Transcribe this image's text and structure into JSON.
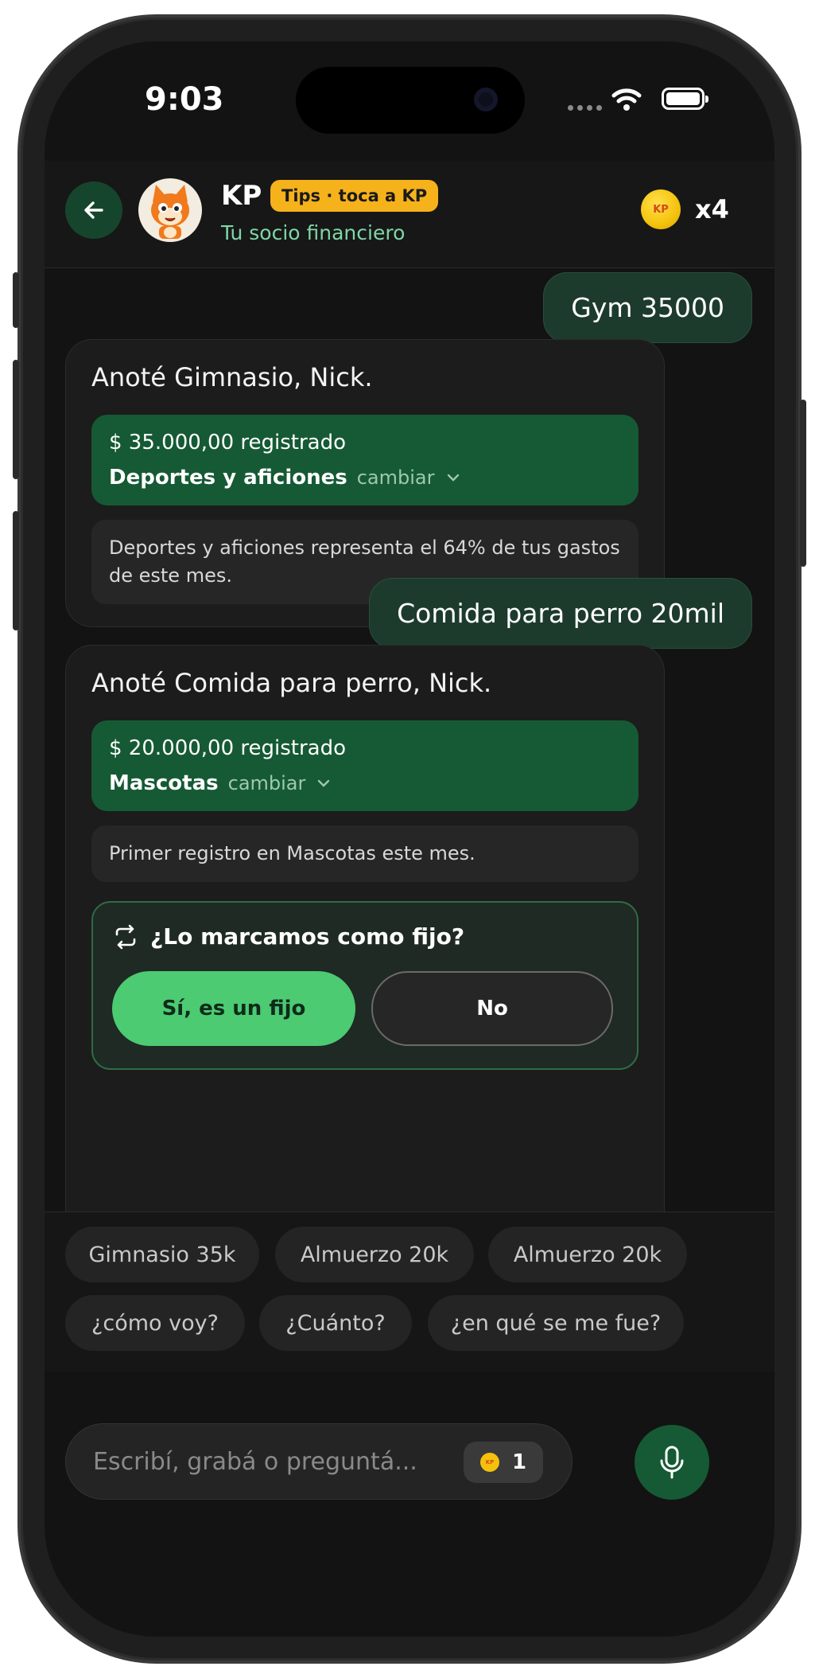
{
  "status_bar": {
    "time": "9:03"
  },
  "header": {
    "agent_name": "KP",
    "tips_badge": "Tips · toca a KP",
    "subtitle": "Tu socio financiero",
    "coin_label": "KP",
    "coin_multiplier": "x4"
  },
  "chat": {
    "messages": [
      {
        "role": "user",
        "text": "Gym 35000"
      },
      {
        "role": "bot",
        "title": "Anoté Gimnasio, Nick.",
        "amount": "$ 35.000,00 registrado",
        "category": "Deportes y aficiones",
        "change_label": "cambiar",
        "info": "Deportes y aficiones representa el 64% de tus gastos de este mes."
      },
      {
        "role": "user",
        "text": "Comida para perro 20mil"
      },
      {
        "role": "bot",
        "title": "Anoté Comida para perro, Nick.",
        "amount": "$ 20.000,00 registrado",
        "category": "Mascotas",
        "change_label": "cambiar",
        "info": "Primer registro en Mascotas este mes.",
        "fixed_prompt": {
          "question": "¿Lo marcamos como fijo?",
          "yes_label": "Sí, es un fijo",
          "no_label": "No"
        }
      }
    ]
  },
  "quick_chips": [
    "Gimnasio 35k",
    "Almuerzo 20k",
    "Almuerzo 20k",
    "¿cómo voy?",
    "¿Cuánto?",
    "¿en qué se me fue?"
  ],
  "composer": {
    "placeholder": "Escribí, grabá o preguntá...",
    "credit_coin_label": "KP",
    "credits": "1"
  },
  "colors": {
    "accent_green": "#155a34",
    "user_bubble": "#1c3b2d",
    "yes_button": "#4ccb72",
    "badge_yellow": "#f6b21b",
    "subtitle_green": "#7fd6a8",
    "background": "#131313"
  },
  "icons": [
    "arrow-left-icon",
    "repeat-icon",
    "chevron-down-icon",
    "microphone-icon",
    "wifi-icon",
    "battery-icon",
    "coin-icon",
    "cat-avatar"
  ]
}
